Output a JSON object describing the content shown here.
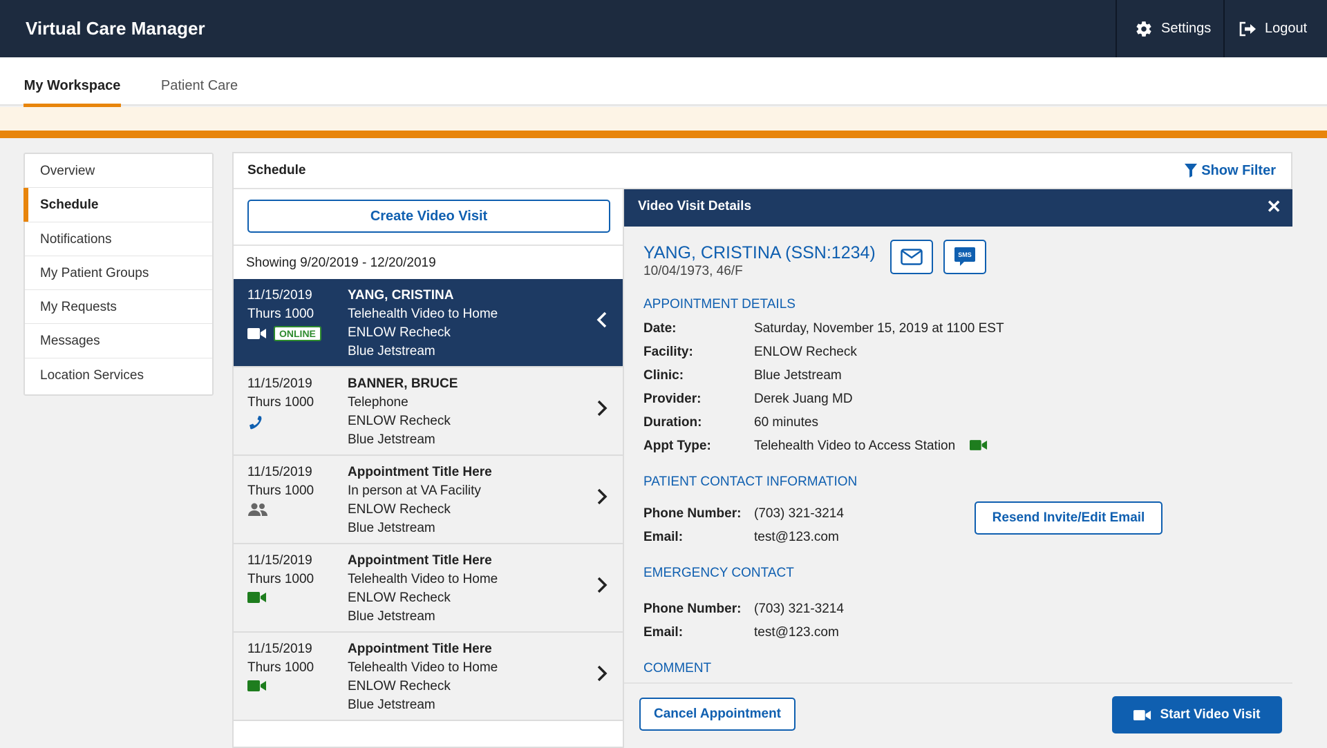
{
  "app": {
    "title": "Virtual Care Manager"
  },
  "topbar": {
    "settings_label": "Settings",
    "logout_label": "Logout"
  },
  "tabs": [
    {
      "label": "My Workspace"
    },
    {
      "label": "Patient Care"
    }
  ],
  "sidebar": {
    "items": [
      {
        "label": "Overview"
      },
      {
        "label": "Schedule"
      },
      {
        "label": "Notifications"
      },
      {
        "label": "My Patient Groups"
      },
      {
        "label": "My Requests"
      },
      {
        "label": "Messages"
      },
      {
        "label": "Location Services"
      }
    ]
  },
  "schedule": {
    "title": "Schedule",
    "show_filter_label": "Show Filter",
    "create_button": "Create Video Visit",
    "showing": "Showing 9/20/2019 - 12/20/2019",
    "appointments": [
      {
        "date": "11/15/2019",
        "time": "Thurs 1000",
        "title": "YANG, CRISTINA",
        "type": "Telehealth Video to Home",
        "facility": "ENLOW Recheck",
        "clinic": "Blue Jetstream",
        "icon": "video-icon",
        "badge": "ONLINE"
      },
      {
        "date": "11/15/2019",
        "time": "Thurs 1000",
        "title": "BANNER, BRUCE",
        "type": "Telephone",
        "facility": "ENLOW Recheck",
        "clinic": "Blue Jetstream",
        "icon": "phone-icon"
      },
      {
        "date": "11/15/2019",
        "time": "Thurs 1000",
        "title": "Appointment Title Here",
        "type": "In person at VA Facility",
        "facility": "ENLOW Recheck",
        "clinic": "Blue Jetstream",
        "icon": "people-icon"
      },
      {
        "date": "11/15/2019",
        "time": "Thurs 1000",
        "title": "Appointment Title Here",
        "type": "Telehealth Video to Home",
        "facility": "ENLOW Recheck",
        "clinic": "Blue Jetstream",
        "icon": "video-icon"
      },
      {
        "date": "11/15/2019",
        "time": "Thurs 1000",
        "title": "Appointment Title Here",
        "type": "Telehealth Video to Home",
        "facility": "ENLOW Recheck",
        "clinic": "Blue Jetstream",
        "icon": "video-icon"
      }
    ]
  },
  "details": {
    "header": "Video Visit Details",
    "close_label": "✕",
    "patient_name": "YANG, CRISTINA (SSN:1234)",
    "patient_dob": "10/04/1973, 46/F",
    "sms_label": "SMS",
    "appointment_heading": "APPOINTMENT DETAILS",
    "appointment": {
      "date_label": "Date:",
      "date": "Saturday, November 15, 2019 at 1100 EST",
      "facility_label": "Facility:",
      "facility": "ENLOW Recheck",
      "clinic_label": "Clinic:",
      "clinic": "Blue Jetstream",
      "provider_label": "Provider:",
      "provider": "Derek Juang MD",
      "duration_label": "Duration:",
      "duration": "60 minutes",
      "appt_type_label": "Appt Type:",
      "appt_type": "Telehealth Video to Access Station"
    },
    "contact_heading": "PATIENT CONTACT INFORMATION",
    "contact": {
      "phone_label": "Phone Number:",
      "phone": "(703) 321-3214",
      "email_label": "Email:",
      "email": "test@123.com"
    },
    "resend_button": "Resend Invite/Edit Email",
    "emergency_heading": "EMERGENCY CONTACT",
    "emergency": {
      "phone_label": "Phone Number:",
      "phone": "(703) 321-3214",
      "email_label": "Email:",
      "email": "test@123.com"
    },
    "comment_heading": "COMMENT",
    "cancel_button": "Cancel Appointment",
    "start_button": "Start Video Visit"
  },
  "colors": {
    "navy": "#1d2b3f",
    "accent_orange": "#e8850c",
    "link_blue": "#0f5fb0",
    "selected_row": "#1d3a63",
    "online_green": "#2e8b2e"
  }
}
